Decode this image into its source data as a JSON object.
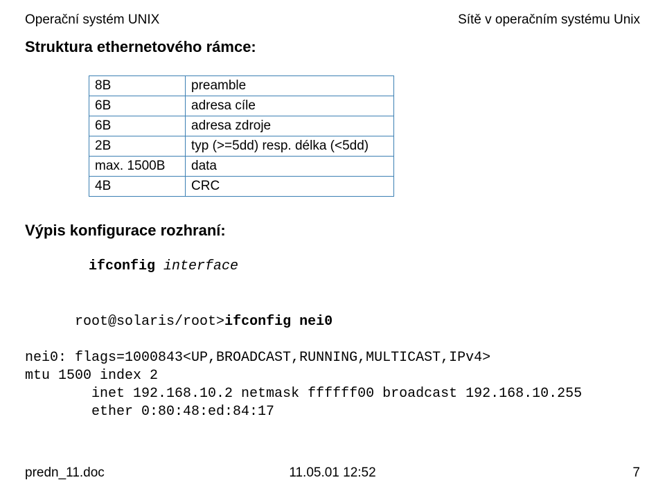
{
  "header": {
    "left": "Operační systém UNIX",
    "right": "Sítě v operačním systému Unix"
  },
  "section1_title": "Struktura ethernetového rámce:",
  "frame_table": [
    {
      "size": "8B",
      "desc": "preamble"
    },
    {
      "size": "6B",
      "desc": "adresa cíle"
    },
    {
      "size": "6B",
      "desc": "adresa zdroje"
    },
    {
      "size": "2B",
      "desc": "typ (>=5dd) resp. délka (<5dd)"
    },
    {
      "size": "max. 1500B",
      "desc": "data"
    },
    {
      "size": "4B",
      "desc": "CRC"
    }
  ],
  "section2_title": "Výpis konfigurace rozhraní:",
  "command": {
    "cmd": "ifconfig",
    "arg": "interface"
  },
  "output": {
    "prompt_prefix": "root@solaris/root>",
    "prompt_cmd": "ifconfig nei0",
    "lines": [
      "nei0: flags=1000843<UP,BROADCAST,RUNNING,MULTICAST,IPv4>",
      "mtu 1500 index 2",
      "        inet 192.168.10.2 netmask ffffff00 broadcast 192.168.10.255",
      "        ether 0:80:48:ed:84:17"
    ]
  },
  "footer": {
    "left": "predn_11.doc",
    "center": "11.05.01 12:52",
    "right": "7"
  }
}
